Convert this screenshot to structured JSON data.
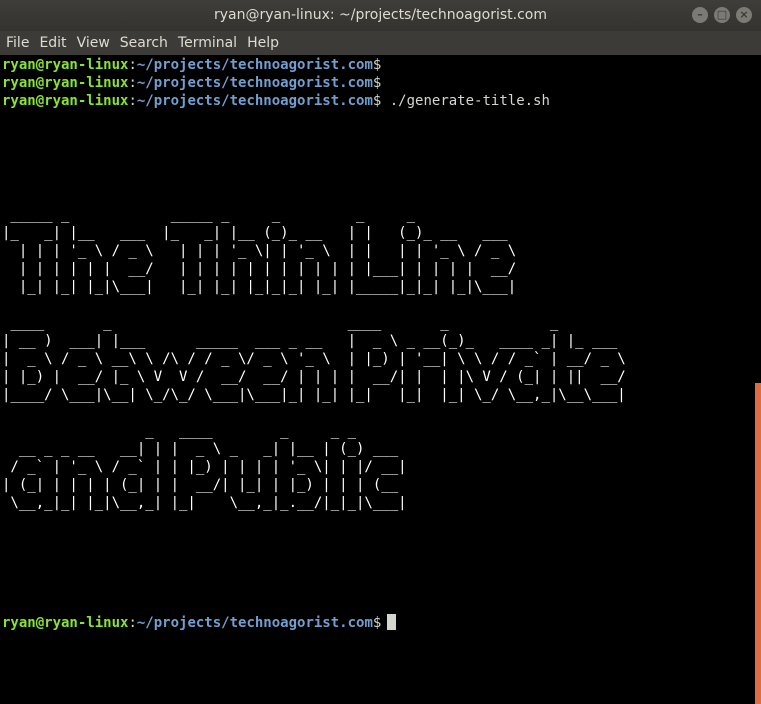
{
  "window": {
    "title": "ryan@ryan-linux: ~/projects/technoagorist.com",
    "buttons": {
      "minimize": "–",
      "maximize": "□",
      "close": "×"
    }
  },
  "menubar": {
    "items": [
      "File",
      "Edit",
      "View",
      "Search",
      "Terminal",
      "Help"
    ]
  },
  "terminal": {
    "prompt_user": "ryan@ryan-linux",
    "prompt_sep": ":",
    "prompt_path": "~/projects/technoagorist.com",
    "prompt_dollar": "$",
    "command": " ./generate-title.sh",
    "ascii_block_1": " _____ _            _____ _     _         _     _            \n|_   _| |__   ___  |_   _| |__ (_)_ __   | |   (_)_ __   ___ \n  | | | '_ \\ / _ \\   | | | '_ \\| | '_ \\  | |   | | '_ \\ / _ \\\n  | | | | | |  __/   | | | | | | | | | | | |___| | | | |  __/\n  |_| |_| |_|\\___|   |_| |_| |_|_|_| |_| |_____|_|_| |_|\\___|",
    "ascii_block_2": " ____       _                            ____       _            _       \n| __ )  ___| |___      _____  ___ _ __   |  _ \\ _ __(_)_   ____ _| |_ ___ \n|  _ \\ / _ \\ __\\ \\ /\\ / / _ \\/ _ \\ '_ \\  | |_) | '__| \\ \\ / / _` | __/ _ \\\n| |_) |  __/ |_ \\ V  V /  __/  __/ | | | |  __/| |  | |\\ V / (_| | ||  __/\n|____/ \\___|\\__| \\_/\\_/ \\___|\\___|_| |_| |_|   |_|  |_| \\_/ \\__,_|\\__\\___|",
    "ascii_block_3": "                 _   ____        _     _ _      \n  __ _ _ __   __| | |  _ \\ _   _| |__ | (_) ___ \n / _` | '_ \\ / _` | | |_) | | | | '_ \\| | |/ __|\n| (_| | | | | (_| | |  __/| |_| | |_) | | | (__ \n \\__,_|_| |_|\\__,_| |_|    \\__,_|_.__/|_|_|\\___|"
  },
  "colors": {
    "prompt_user": "#8ae234",
    "prompt_path": "#729fcf",
    "scrollbar": "#e06d3f",
    "background": "#000000"
  }
}
